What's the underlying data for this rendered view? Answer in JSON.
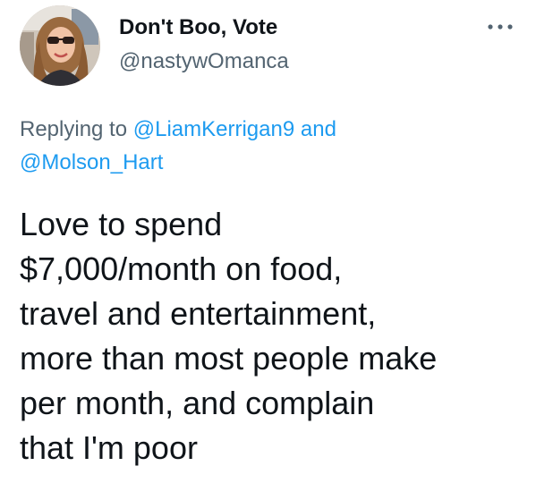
{
  "author": {
    "display_name": "Don't Boo, Vote",
    "handle": "@nastywOmanca",
    "avatar_icon": "profile-photo"
  },
  "more_icon": "more-horizontal-icon",
  "reply_context": {
    "prefix": "Replying to",
    "mention_1": "@LiamKerrigan9",
    "conjunction": "and",
    "mention_2": "@Molson_Hart"
  },
  "tweet_text_lines": [
    "Love to spend",
    "$7,000/month on food,",
    "travel and entertainment,",
    "more than most people make",
    "per month, and complain",
    "that I'm poor"
  ],
  "colors": {
    "link": "#1d9bf0",
    "secondary_text": "#536471",
    "primary_text": "#0f1419"
  }
}
